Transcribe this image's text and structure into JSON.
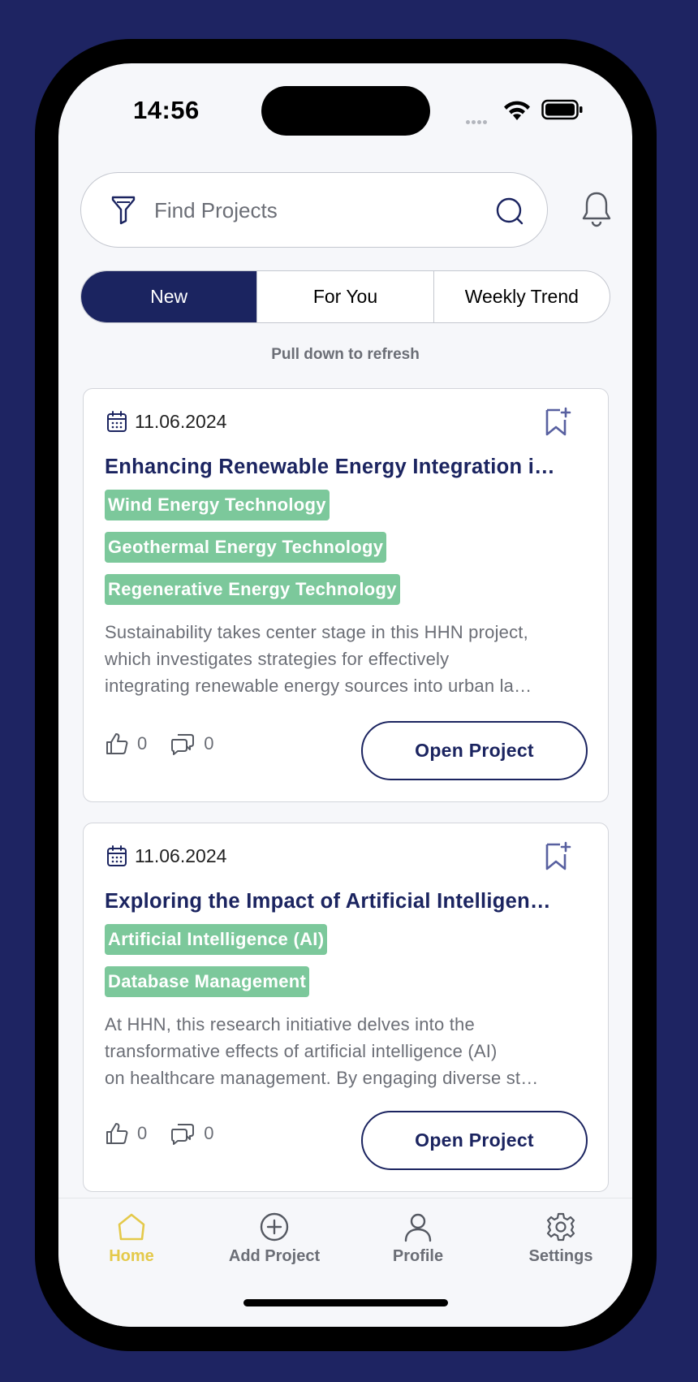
{
  "status_bar": {
    "time": "14:56",
    "icons": [
      "cellular-dots-icon",
      "wifi-icon",
      "battery-icon"
    ]
  },
  "search": {
    "placeholder": "Find Projects",
    "icons": [
      "filter-icon",
      "search-icon",
      "bell-icon"
    ]
  },
  "tabs": [
    {
      "label": "New",
      "active": true
    },
    {
      "label": "For You",
      "active": false
    },
    {
      "label": "Weekly Trend",
      "active": false
    }
  ],
  "refresh_hint": "Pull down to refresh",
  "projects": [
    {
      "date": "11.06.2024",
      "title": "Enhancing Renewable Energy Integration i…",
      "tags": [
        "Wind Energy Technology",
        "Geothermal Energy Technology",
        "Regenerative Energy Technology"
      ],
      "description": [
        "Sustainability takes center stage in this HHN project,",
        "which investigates strategies for effectively",
        "integrating renewable energy sources into urban la…"
      ],
      "likes": "0",
      "comments": "0",
      "button_label": "Open Project"
    },
    {
      "date": "11.06.2024",
      "title": "Exploring the Impact of Artificial Intelligen…",
      "tags": [
        "Artificial Intelligence (AI)",
        "Database Management"
      ],
      "description": [
        "At HHN, this research initiative delves into the",
        "transformative effects of artificial intelligence (AI)",
        "on healthcare management. By engaging diverse st…"
      ],
      "likes": "0",
      "comments": "0",
      "button_label": "Open Project"
    }
  ],
  "tabbar": [
    {
      "label": "Home",
      "icon": "home-icon",
      "active": true
    },
    {
      "label": "Add Project",
      "icon": "add-circle-icon",
      "active": false
    },
    {
      "label": "Profile",
      "icon": "person-icon",
      "active": false
    },
    {
      "label": "Settings",
      "icon": "gear-icon",
      "active": false
    }
  ],
  "colors": {
    "background": "#1e2462",
    "primary": "#1b2460",
    "tag": "#7cc89b",
    "active_tab_icon": "#e4c94a"
  }
}
